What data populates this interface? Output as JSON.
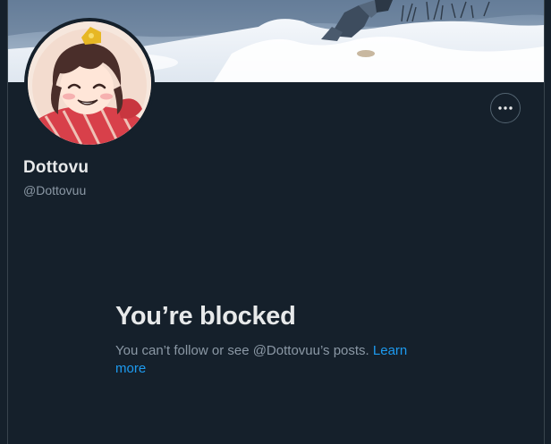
{
  "profile": {
    "display_name": "Dottovu",
    "handle": "@Dottovuu",
    "banner_icon": "snowy-landscape-banner",
    "avatar_icon": "anime-girl-avatar"
  },
  "actions": {
    "more_icon": "more-horizontal-icon"
  },
  "blocked": {
    "title": "You’re blocked",
    "message": "You can’t follow or see @Dottovuu’s posts.",
    "learn_more": "Learn more"
  },
  "colors": {
    "background": "#15202b",
    "primary_text": "#e7e9ea",
    "secondary_text": "#8b98a5",
    "link": "#1d9bf0",
    "border": "#38444d"
  }
}
